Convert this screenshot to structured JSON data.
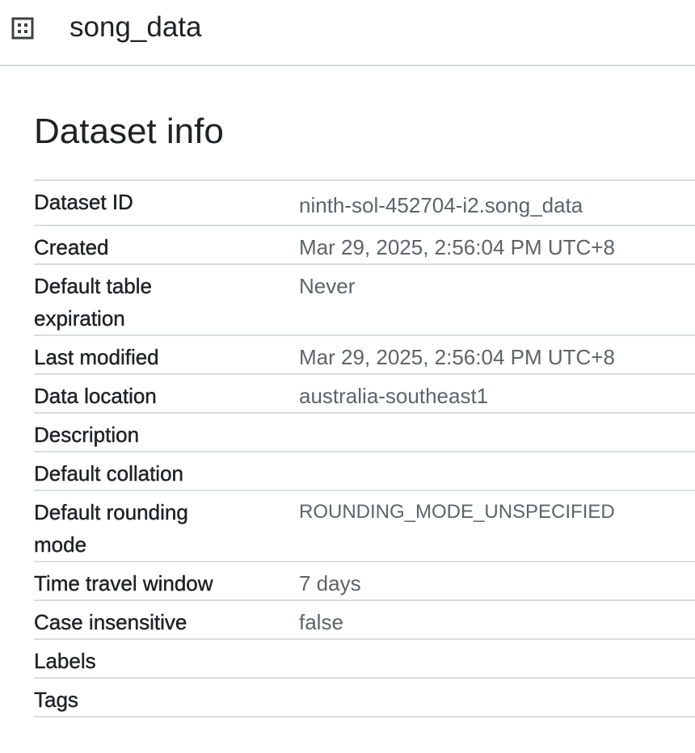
{
  "header": {
    "icon": "dataset-grid-icon",
    "title": "song_data"
  },
  "section": {
    "title": "Dataset info"
  },
  "rows": [
    {
      "label": "Dataset ID",
      "value": "ninth-sol-452704-i2.song_data"
    },
    {
      "label": "Created",
      "value": "Mar 29, 2025, 2:56:04 PM UTC+8"
    },
    {
      "label": "Default table expiration",
      "value": "Never"
    },
    {
      "label": "Last modified",
      "value": "Mar 29, 2025, 2:56:04 PM UTC+8"
    },
    {
      "label": "Data location",
      "value": "australia-southeast1"
    },
    {
      "label": "Description",
      "value": ""
    },
    {
      "label": "Default collation",
      "value": ""
    },
    {
      "label": "Default rounding mode",
      "value": "ROUNDING_MODE_UNSPECIFIED"
    },
    {
      "label": "Time travel window",
      "value": "7 days"
    },
    {
      "label": "Case insensitive",
      "value": "false"
    },
    {
      "label": "Labels",
      "value": ""
    },
    {
      "label": "Tags",
      "value": ""
    }
  ]
}
